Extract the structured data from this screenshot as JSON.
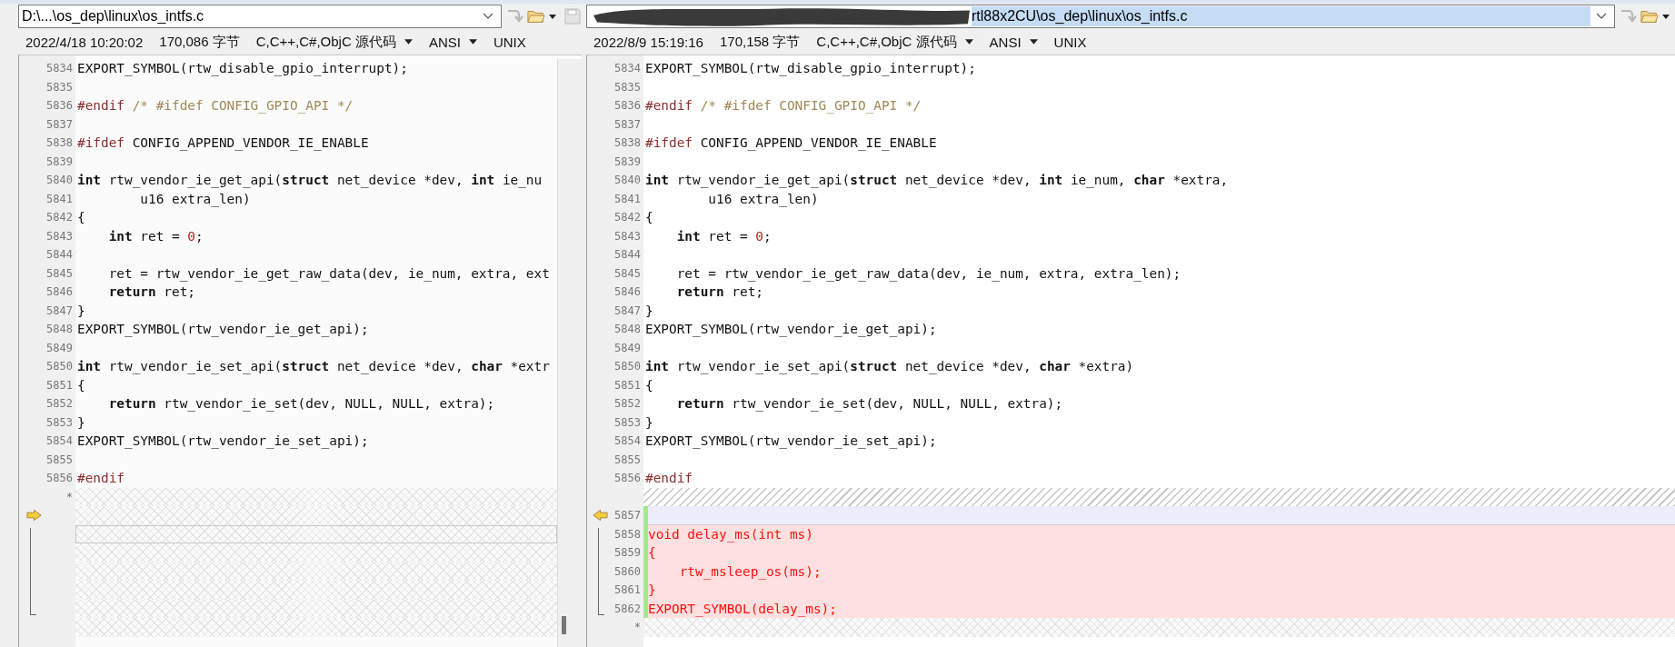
{
  "panes": [
    {
      "path": {
        "value": "D:\\...\\os_dep\\linux\\os_intfs.c",
        "text_selected": false,
        "redacted": false
      },
      "info": {
        "date": "2022/4/18 10:20:02",
        "size": "170,086 字节",
        "format": "C,C++,C#,ObjC 源代码",
        "encoding": "ANSI",
        "line_ending": "UNIX"
      },
      "rows": [
        {
          "number": "5834",
          "kind": "code",
          "segments": [
            {
              "text": "EXPORT_SYMBOL(rtw_disable_gpio_interrupt);",
              "kind": "plain"
            }
          ]
        },
        {
          "number": "5835",
          "kind": "code"
        },
        {
          "number": "5836",
          "kind": "code",
          "segments": [
            {
              "text": "#endif",
              "kind": "directive"
            },
            {
              "text": " /* #ifdef CONFIG_GPIO_API */",
              "kind": "comment"
            }
          ]
        },
        {
          "number": "5837",
          "kind": "code"
        },
        {
          "number": "5838",
          "kind": "code",
          "segments": [
            {
              "text": "#ifdef",
              "kind": "directive"
            },
            {
              "text": " CONFIG_APPEND_VENDOR_IE_ENABLE",
              "kind": "plain"
            }
          ]
        },
        {
          "number": "5839",
          "kind": "code"
        },
        {
          "number": "5840",
          "kind": "code",
          "segments": [
            {
              "text": "int",
              "kind": "keyword"
            },
            {
              "text": " rtw_vendor_ie_get_api(",
              "kind": "plain"
            },
            {
              "text": "struct",
              "kind": "keyword"
            },
            {
              "text": " net_device *dev, ",
              "kind": "plain"
            },
            {
              "text": "int",
              "kind": "keyword"
            },
            {
              "text": " ie_nu",
              "kind": "plain"
            }
          ]
        },
        {
          "number": "5841",
          "kind": "code",
          "segments": [
            {
              "text": "        u16 extra_len)",
              "kind": "plain"
            }
          ]
        },
        {
          "number": "5842",
          "kind": "code",
          "segments": [
            {
              "text": "{",
              "kind": "plain"
            }
          ]
        },
        {
          "number": "5843",
          "kind": "code",
          "segments": [
            {
              "text": "    int",
              "kind": "keyword"
            },
            {
              "text": " ret = ",
              "kind": "plain"
            },
            {
              "text": "0",
              "kind": "number"
            },
            {
              "text": ";",
              "kind": "plain"
            }
          ]
        },
        {
          "number": "5844",
          "kind": "code"
        },
        {
          "number": "5845",
          "kind": "code",
          "segments": [
            {
              "text": "    ret = rtw_vendor_ie_get_raw_data(dev, ie_num, extra, ext",
              "kind": "plain"
            }
          ]
        },
        {
          "number": "5846",
          "kind": "code",
          "segments": [
            {
              "text": "    return",
              "kind": "keyword"
            },
            {
              "text": " ret;",
              "kind": "plain"
            }
          ]
        },
        {
          "number": "5847",
          "kind": "code",
          "segments": [
            {
              "text": "}",
              "kind": "plain"
            }
          ]
        },
        {
          "number": "5848",
          "kind": "code",
          "segments": [
            {
              "text": "EXPORT_SYMBOL(rtw_vendor_ie_get_api);",
              "kind": "plain"
            }
          ]
        },
        {
          "number": "5849",
          "kind": "code"
        },
        {
          "number": "5850",
          "kind": "code",
          "segments": [
            {
              "text": "int",
              "kind": "keyword"
            },
            {
              "text": " rtw_vendor_ie_set_api(",
              "kind": "plain"
            },
            {
              "text": "struct",
              "kind": "keyword"
            },
            {
              "text": " net_device *dev, ",
              "kind": "plain"
            },
            {
              "text": "char",
              "kind": "keyword"
            },
            {
              "text": " *extr",
              "kind": "plain"
            }
          ]
        },
        {
          "number": "5851",
          "kind": "code",
          "segments": [
            {
              "text": "{",
              "kind": "plain"
            }
          ]
        },
        {
          "number": "5852",
          "kind": "code",
          "segments": [
            {
              "text": "    return",
              "kind": "keyword"
            },
            {
              "text": " rtw_vendor_ie_set(dev, NULL, NULL, extra);",
              "kind": "plain"
            }
          ]
        },
        {
          "number": "5853",
          "kind": "code",
          "segments": [
            {
              "text": "}",
              "kind": "plain"
            }
          ]
        },
        {
          "number": "5854",
          "kind": "code",
          "segments": [
            {
              "text": "EXPORT_SYMBOL(rtw_vendor_ie_set_api);",
              "kind": "plain"
            }
          ]
        },
        {
          "number": "5855",
          "kind": "code"
        },
        {
          "number": "5856",
          "kind": "code",
          "segments": [
            {
              "text": "#endif",
              "kind": "directive"
            }
          ]
        },
        {
          "number": "*",
          "kind": "filler"
        },
        {
          "kind": "filler",
          "marker": true
        },
        {
          "kind": "filler",
          "current": true,
          "block": true
        },
        {
          "kind": "filler",
          "block": true
        },
        {
          "kind": "filler",
          "block": true
        },
        {
          "kind": "filler",
          "block": true
        },
        {
          "kind": "filler",
          "block": true
        },
        {
          "kind": "filler"
        }
      ]
    },
    {
      "path": {
        "value": "rtl88x2CU\\os_dep\\linux\\os_intfs.c",
        "text_selected": true,
        "redacted": true
      },
      "info": {
        "date": "2022/8/9 15:19:16",
        "size": "170,158 字节",
        "format": "C,C++,C#,ObjC 源代码",
        "encoding": "ANSI",
        "line_ending": "UNIX"
      },
      "rows": [
        {
          "number": "5834",
          "kind": "code",
          "segments": [
            {
              "text": "EXPORT_SYMBOL(rtw_disable_gpio_interrupt);",
              "kind": "plain"
            }
          ]
        },
        {
          "number": "5835",
          "kind": "code"
        },
        {
          "number": "5836",
          "kind": "code",
          "segments": [
            {
              "text": "#endif",
              "kind": "directive"
            },
            {
              "text": " /* #ifdef CONFIG_GPIO_API */",
              "kind": "comment"
            }
          ]
        },
        {
          "number": "5837",
          "kind": "code"
        },
        {
          "number": "5838",
          "kind": "code",
          "segments": [
            {
              "text": "#ifdef",
              "kind": "directive"
            },
            {
              "text": " CONFIG_APPEND_VENDOR_IE_ENABLE",
              "kind": "plain"
            }
          ]
        },
        {
          "number": "5839",
          "kind": "code"
        },
        {
          "number": "5840",
          "kind": "code",
          "segments": [
            {
              "text": "int",
              "kind": "keyword"
            },
            {
              "text": " rtw_vendor_ie_get_api(",
              "kind": "plain"
            },
            {
              "text": "struct",
              "kind": "keyword"
            },
            {
              "text": " net_device *dev, ",
              "kind": "plain"
            },
            {
              "text": "int",
              "kind": "keyword"
            },
            {
              "text": " ie_num, ",
              "kind": "plain"
            },
            {
              "text": "char",
              "kind": "keyword"
            },
            {
              "text": " *extra,",
              "kind": "plain"
            }
          ]
        },
        {
          "number": "5841",
          "kind": "code",
          "segments": [
            {
              "text": "        u16 extra_len)",
              "kind": "plain"
            }
          ]
        },
        {
          "number": "5842",
          "kind": "code",
          "segments": [
            {
              "text": "{",
              "kind": "plain"
            }
          ]
        },
        {
          "number": "5843",
          "kind": "code",
          "segments": [
            {
              "text": "    int",
              "kind": "keyword"
            },
            {
              "text": " ret = ",
              "kind": "plain"
            },
            {
              "text": "0",
              "kind": "number"
            },
            {
              "text": ";",
              "kind": "plain"
            }
          ]
        },
        {
          "number": "5844",
          "kind": "code"
        },
        {
          "number": "5845",
          "kind": "code",
          "segments": [
            {
              "text": "    ret = rtw_vendor_ie_get_raw_data(dev, ie_num, extra, extra_len);",
              "kind": "plain"
            }
          ]
        },
        {
          "number": "5846",
          "kind": "code",
          "segments": [
            {
              "text": "    return",
              "kind": "keyword"
            },
            {
              "text": " ret;",
              "kind": "plain"
            }
          ]
        },
        {
          "number": "5847",
          "kind": "code",
          "segments": [
            {
              "text": "}",
              "kind": "plain"
            }
          ]
        },
        {
          "number": "5848",
          "kind": "code",
          "segments": [
            {
              "text": "EXPORT_SYMBOL(rtw_vendor_ie_get_api);",
              "kind": "plain"
            }
          ]
        },
        {
          "number": "5849",
          "kind": "code"
        },
        {
          "number": "5850",
          "kind": "code",
          "segments": [
            {
              "text": "int",
              "kind": "keyword"
            },
            {
              "text": " rtw_vendor_ie_set_api(",
              "kind": "plain"
            },
            {
              "text": "struct",
              "kind": "keyword"
            },
            {
              "text": " net_device *dev, ",
              "kind": "plain"
            },
            {
              "text": "char",
              "kind": "keyword"
            },
            {
              "text": " *extra)",
              "kind": "plain"
            }
          ]
        },
        {
          "number": "5851",
          "kind": "code",
          "segments": [
            {
              "text": "{",
              "kind": "plain"
            }
          ]
        },
        {
          "number": "5852",
          "kind": "code",
          "segments": [
            {
              "text": "    return",
              "kind": "keyword"
            },
            {
              "text": " rtw_vendor_ie_set(dev, NULL, NULL, extra);",
              "kind": "plain"
            }
          ]
        },
        {
          "number": "5853",
          "kind": "code",
          "segments": [
            {
              "text": "}",
              "kind": "plain"
            }
          ]
        },
        {
          "number": "5854",
          "kind": "code",
          "segments": [
            {
              "text": "EXPORT_SYMBOL(rtw_vendor_ie_set_api);",
              "kind": "plain"
            }
          ]
        },
        {
          "number": "5855",
          "kind": "code"
        },
        {
          "number": "5856",
          "kind": "code",
          "segments": [
            {
              "text": "#endif",
              "kind": "directive"
            }
          ]
        },
        {
          "kind": "gap"
        },
        {
          "number": "5857",
          "kind": "blank",
          "marker": true
        },
        {
          "number": "5858",
          "kind": "added",
          "block": true,
          "segments": [
            {
              "text": "void delay_ms(int ms)",
              "kind": "plain"
            }
          ]
        },
        {
          "number": "5859",
          "kind": "added",
          "block": true,
          "segments": [
            {
              "text": "{",
              "kind": "plain"
            }
          ]
        },
        {
          "number": "5860",
          "kind": "added",
          "block": true,
          "segments": [
            {
              "text": "    rtw_msleep_os(ms);",
              "kind": "plain"
            }
          ]
        },
        {
          "number": "5861",
          "kind": "added",
          "block": true,
          "segments": [
            {
              "text": "}",
              "kind": "plain"
            }
          ]
        },
        {
          "number": "5862",
          "kind": "added",
          "block": true,
          "segments": [
            {
              "text": "EXPORT_SYMBOL(delay_ms);",
              "kind": "plain"
            }
          ]
        },
        {
          "number": "*",
          "kind": "filler"
        }
      ]
    }
  ]
}
